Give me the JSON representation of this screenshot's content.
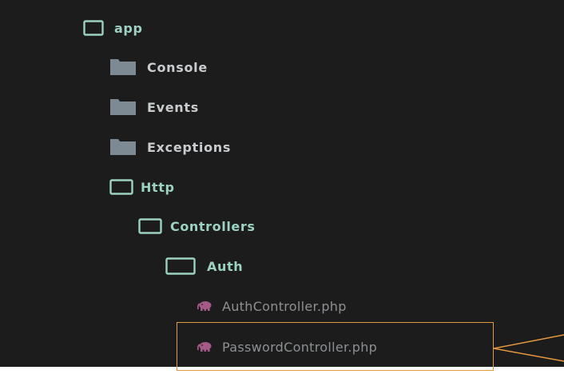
{
  "tree": {
    "root": {
      "label": "app",
      "icon": "folder-open-icon",
      "expanded": true
    },
    "folders": [
      {
        "key": "console",
        "label": "Console",
        "icon": "folder-closed-icon",
        "expanded": false
      },
      {
        "key": "events",
        "label": "Events",
        "icon": "folder-closed-icon",
        "expanded": false
      },
      {
        "key": "exceptions",
        "label": "Exceptions",
        "icon": "folder-closed-icon",
        "expanded": false
      },
      {
        "key": "http",
        "label": "Http",
        "icon": "folder-open-icon",
        "expanded": true
      },
      {
        "key": "controllers",
        "label": "Controllers",
        "icon": "folder-open-icon",
        "expanded": true
      },
      {
        "key": "auth",
        "label": "Auth",
        "icon": "folder-open-icon",
        "expanded": true
      }
    ],
    "files": [
      {
        "label": "AuthController.php",
        "icon": "php-elephant-icon"
      },
      {
        "label": "PasswordController.php",
        "icon": "php-elephant-icon",
        "highlighted": true
      }
    ]
  },
  "colors": {
    "background": "#1c1c1c",
    "expanded_folder": "#9bd2c2",
    "collapsed_folder_label": "#c9ccce",
    "collapsed_folder_icon": "#7d8a93",
    "file_label": "#8d9093",
    "php_icon": "#a45a86",
    "highlight": "#e5993f"
  }
}
